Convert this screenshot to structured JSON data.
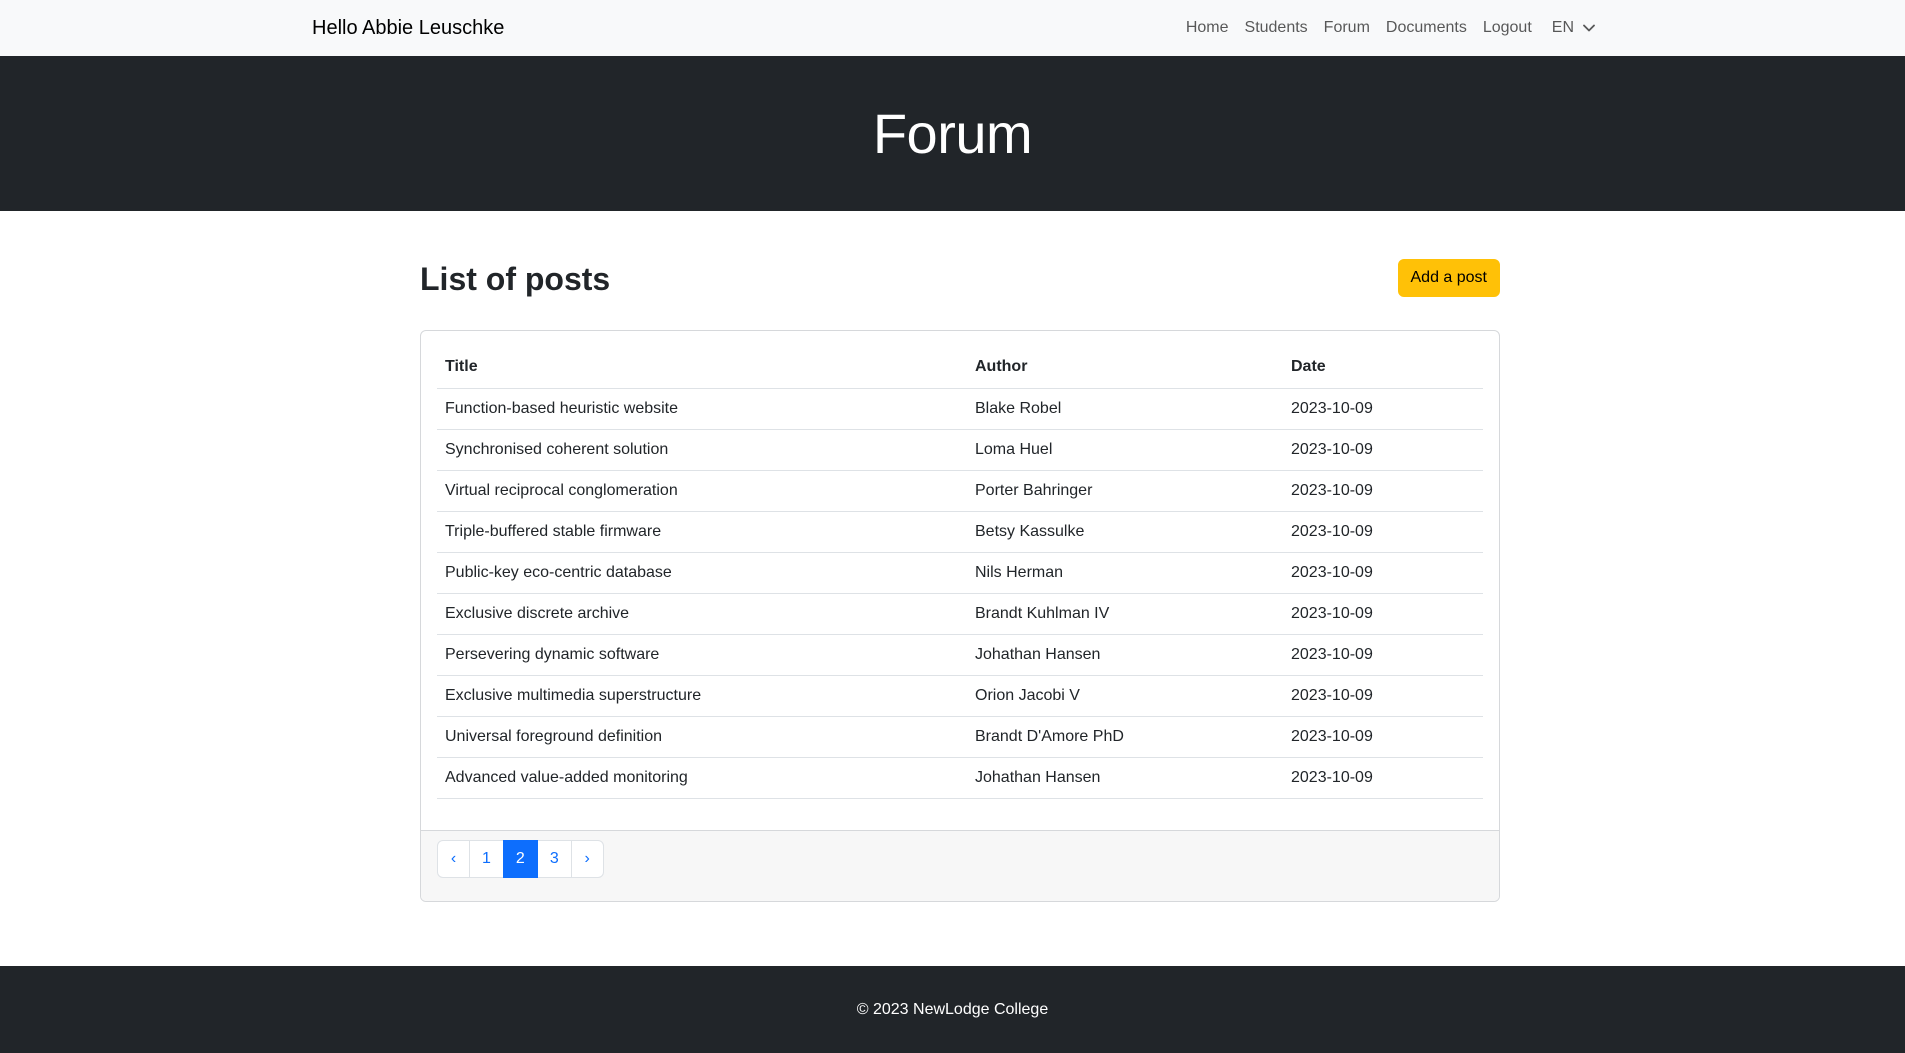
{
  "navbar": {
    "brand": "Hello Abbie Leuschke",
    "links": [
      "Home",
      "Students",
      "Forum",
      "Documents",
      "Logout"
    ],
    "language": "EN"
  },
  "hero": {
    "title": "Forum"
  },
  "main": {
    "heading": "List of posts",
    "add_button": "Add a post",
    "table": {
      "columns": [
        "Title",
        "Author",
        "Date"
      ],
      "rows": [
        [
          "Function-based heuristic website",
          "Blake Robel",
          "2023-10-09"
        ],
        [
          "Synchronised coherent solution",
          "Loma Huel",
          "2023-10-09"
        ],
        [
          "Virtual reciprocal conglomeration",
          "Porter Bahringer",
          "2023-10-09"
        ],
        [
          "Triple-buffered stable firmware",
          "Betsy Kassulke",
          "2023-10-09"
        ],
        [
          "Public-key eco-centric database",
          "Nils Herman",
          "2023-10-09"
        ],
        [
          "Exclusive discrete archive",
          "Brandt Kuhlman IV",
          "2023-10-09"
        ],
        [
          "Persevering dynamic software",
          "Johathan Hansen",
          "2023-10-09"
        ],
        [
          "Exclusive multimedia superstructure",
          "Orion Jacobi V",
          "2023-10-09"
        ],
        [
          "Universal foreground definition",
          "Brandt D'Amore PhD",
          "2023-10-09"
        ],
        [
          "Advanced value-added monitoring",
          "Johathan Hansen",
          "2023-10-09"
        ]
      ]
    },
    "pagination": {
      "prev": "‹",
      "pages": [
        "1",
        "2",
        "3"
      ],
      "current": "2",
      "next": "›"
    }
  },
  "footer": {
    "text": "© 2023 NewLodge College"
  },
  "colors": {
    "accent": "#ffc107",
    "primary": "#0d6efd",
    "dark": "#212529"
  }
}
